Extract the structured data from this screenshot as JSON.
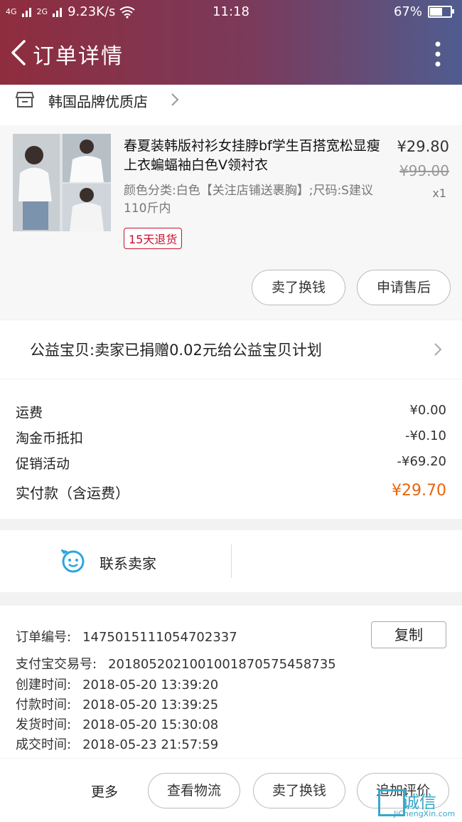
{
  "status_bar": {
    "network": "4G",
    "network2": "2G",
    "speed": "9.23K/s",
    "time": "11:18",
    "battery": "67%",
    "battery_level": 0.67
  },
  "header": {
    "title": "订单详情"
  },
  "shop": {
    "name": "韩国品牌优质店"
  },
  "product": {
    "title": "春夏装韩版衬衫女挂脖bf学生百搭宽松显瘦上衣蝙蝠袖白色V领衬衣",
    "spec": "颜色分类:白色【关注店铺送裹胸】;尺码:S建议110斤内",
    "price": "¥29.80",
    "original_price": "¥99.00",
    "quantity": "x1",
    "tag": "15天退货",
    "btn_sell": "卖了换钱",
    "btn_after_sale": "申请售后"
  },
  "charity": {
    "text": "公益宝贝:卖家已捐赠0.02元给公益宝贝计划"
  },
  "costs": {
    "shipping_label": "运费",
    "shipping_value": "¥0.00",
    "coin_label": "淘金币抵扣",
    "coin_value": "-¥0.10",
    "promo_label": "促销活动",
    "promo_value": "-¥69.20",
    "total_label": "实付款（含运费）",
    "total_value": "¥29.70"
  },
  "contact": {
    "label": "联系卖家"
  },
  "order_info": {
    "order_no_label": "订单编号:",
    "order_no": "1475015111054702337",
    "copy_label": "复制",
    "alipay_label": "支付宝交易号:",
    "alipay_no": "2018052021001001870575458735",
    "created_label": "创建时间:",
    "created": "2018-05-20 13:39:20",
    "paid_label": "付款时间:",
    "paid": "2018-05-20 13:39:25",
    "shipped_label": "发货时间:",
    "shipped": "2018-05-20 15:30:08",
    "completed_label": "成交时间:",
    "completed": "2018-05-23 21:57:59"
  },
  "footer": {
    "more": "更多",
    "logistics": "查看物流",
    "sell": "卖了换钱",
    "review": "追加评价"
  },
  "watermark": {
    "text": "诚信",
    "sub": "JiChengXin.com"
  },
  "colors": {
    "header_start": "#8f2d3e",
    "header_end": "#4f5d90",
    "price_total": "#e8650f",
    "tag": "#c8102e",
    "contact_icon": "#2aa7e0"
  }
}
